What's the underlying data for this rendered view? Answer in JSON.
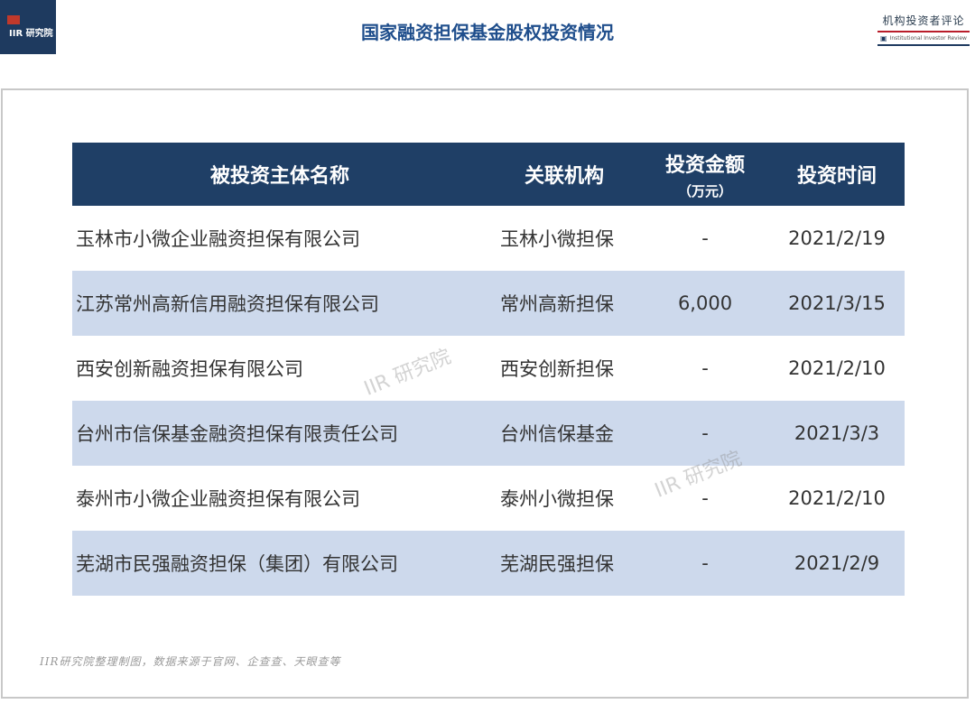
{
  "header": {
    "logo_text": "IIR 研究院",
    "title": "国家融资担保基金股权投资情况",
    "brand_cn": "机构投资者评论",
    "brand_en": "Institutional Investor Review"
  },
  "table": {
    "headers": {
      "name": "被投资主体名称",
      "assoc": "关联机构",
      "amount": "投资金额",
      "amount_unit": "（万元）",
      "date": "投资时间"
    },
    "rows": [
      {
        "name": "玉林市小微企业融资担保有限公司",
        "assoc": "玉林小微担保",
        "amount": "-",
        "date": "2021/2/19"
      },
      {
        "name": "江苏常州高新信用融资担保有限公司",
        "assoc": "常州高新担保",
        "amount": "6,000",
        "date": "2021/3/15"
      },
      {
        "name": "西安创新融资担保有限公司",
        "assoc": "西安创新担保",
        "amount": "-",
        "date": "2021/2/10"
      },
      {
        "name": "台州市信保基金融资担保有限责任公司",
        "assoc": "台州信保基金",
        "amount": "-",
        "date": "2021/3/3"
      },
      {
        "name": "泰州市小微企业融资担保有限公司",
        "assoc": "泰州小微担保",
        "amount": "-",
        "date": "2021/2/10"
      },
      {
        "name": "芜湖市民强融资担保（集团）有限公司",
        "assoc": "芜湖民强担保",
        "amount": "-",
        "date": "2021/2/9"
      }
    ]
  },
  "watermarks": [
    "IIR 研究院",
    "IIR 研究院"
  ],
  "footer": "IIR研究院整理制图，数据来源于官网、企查查、天眼查等",
  "colors": {
    "header_bg": "#1f3f66",
    "band_bg": "#cdd9ec",
    "title": "#1f4e8c",
    "logo_bg": "#1e3a5f"
  }
}
